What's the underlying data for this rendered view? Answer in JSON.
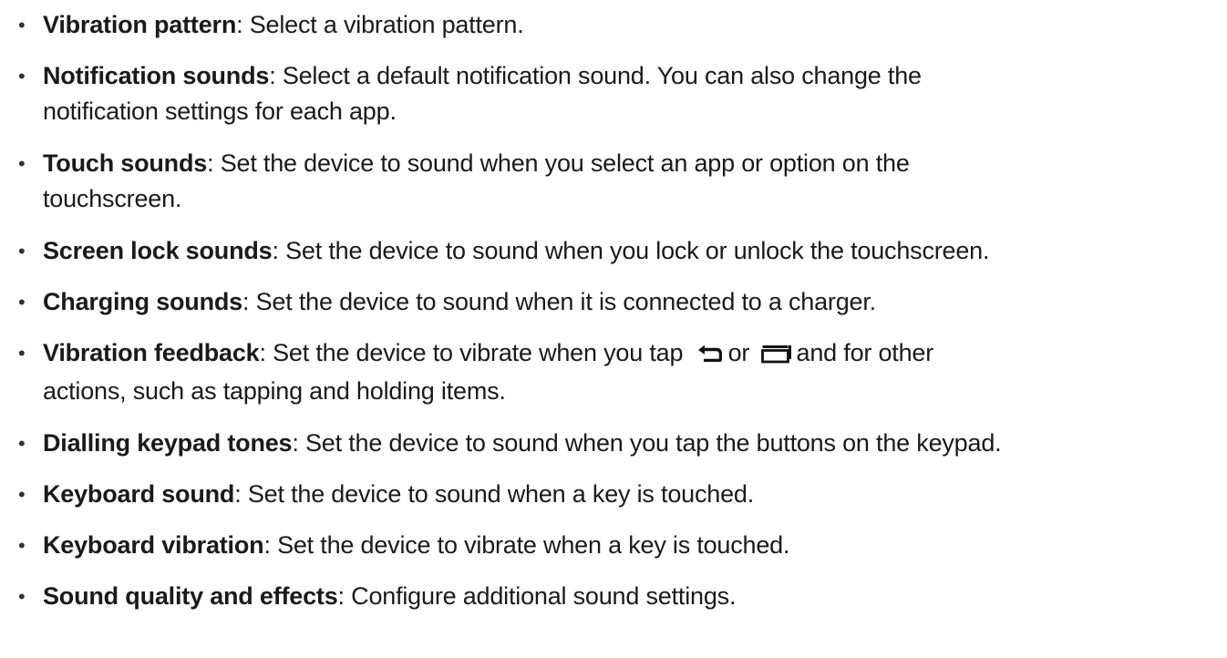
{
  "items": [
    {
      "term": "Vibration pattern",
      "sep": ": ",
      "lines": [
        "Select a vibration pattern."
      ]
    },
    {
      "term": "Notification sounds",
      "sep": ": ",
      "lines": [
        "Select a default notification sound. You can also change the",
        "notification settings for each app."
      ]
    },
    {
      "term": "Touch sounds",
      "sep": ": ",
      "lines": [
        "Set the device to sound when you select an app or option on the",
        "touchscreen."
      ]
    },
    {
      "term": "Screen lock sounds",
      "sep": ": ",
      "lines": [
        "Set the device to sound when you lock or unlock the touchscreen."
      ]
    },
    {
      "term": "Charging sounds",
      "sep": ": ",
      "lines": [
        "Set the device to sound when it is connected to a charger."
      ]
    },
    {
      "term": "Vibration feedback",
      "sep": ": ",
      "text_a": "Set the device to vibrate when you tap",
      "text_b": "or",
      "text_c": "and for other",
      "line2": "actions, such as tapping and holding items.",
      "icons": [
        "back-icon",
        "recent-apps-icon"
      ]
    },
    {
      "term": "Dialling keypad tones",
      "sep": ": ",
      "lines": [
        "Set the device to sound when you tap the buttons on the keypad."
      ]
    },
    {
      "term": "Keyboard sound",
      "sep": ": ",
      "lines": [
        "Set the device to sound when a key is touched."
      ]
    },
    {
      "term": "Keyboard vibration",
      "sep": ": ",
      "lines": [
        "Set the device to vibrate when a key is touched."
      ]
    },
    {
      "term": "Sound quality and effects",
      "sep": ": ",
      "lines": [
        "Configure additional sound settings."
      ]
    }
  ],
  "bullet": "•"
}
